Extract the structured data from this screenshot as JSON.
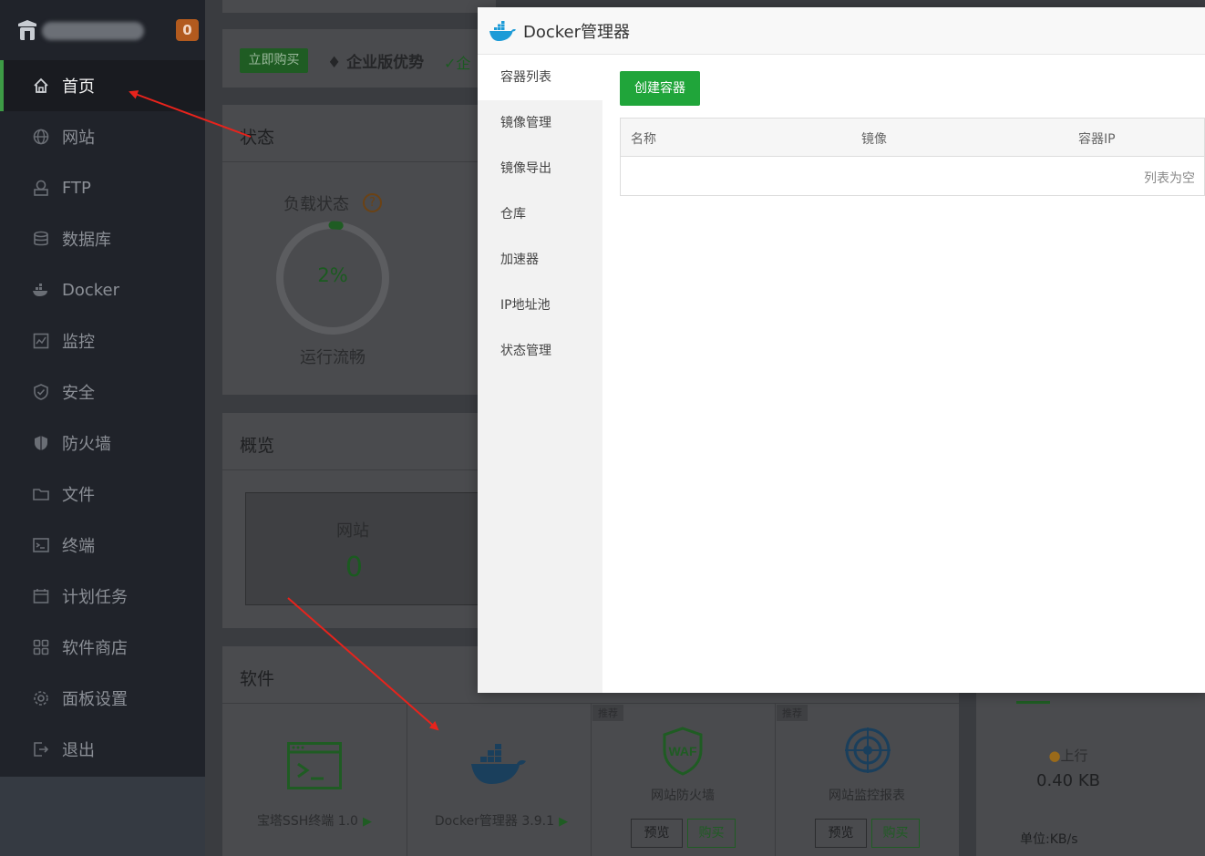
{
  "sidebar": {
    "badge": "0",
    "items": [
      {
        "label": "首页",
        "icon": "home-icon"
      },
      {
        "label": "网站",
        "icon": "globe-icon"
      },
      {
        "label": "FTP",
        "icon": "ftp-icon"
      },
      {
        "label": "数据库",
        "icon": "database-icon"
      },
      {
        "label": "Docker",
        "icon": "docker-icon"
      },
      {
        "label": "监控",
        "icon": "monitor-icon"
      },
      {
        "label": "安全",
        "icon": "shield-icon"
      },
      {
        "label": "防火墙",
        "icon": "firewall-icon"
      },
      {
        "label": "文件",
        "icon": "folder-icon"
      },
      {
        "label": "终端",
        "icon": "terminal-icon"
      },
      {
        "label": "计划任务",
        "icon": "calendar-icon"
      },
      {
        "label": "软件商店",
        "icon": "apps-icon"
      },
      {
        "label": "面板设置",
        "icon": "gear-icon"
      },
      {
        "label": "退出",
        "icon": "logout-icon"
      }
    ]
  },
  "topbar": {
    "buy_label": "立即购买",
    "enterprise_label": "企业版优势",
    "check_label": "企"
  },
  "status": {
    "title": "状态",
    "load_label": "负载状态",
    "help": "?",
    "load_value": "2%",
    "load_percent": 2,
    "load_state": "运行流畅"
  },
  "overview": {
    "title": "概览",
    "site_label": "网站",
    "site_value": "0"
  },
  "software": {
    "title": "软件",
    "items": [
      {
        "name": "宝塔SSH终端 1.0"
      },
      {
        "name": "Docker管理器 3.9.1"
      },
      {
        "name": "网站防火墙",
        "tag": "推荐",
        "preview": "预览",
        "buy": "购买"
      },
      {
        "name": "网站监控报表",
        "tag": "推荐",
        "preview": "预览",
        "buy": "购买"
      }
    ],
    "waf_text": "WAF"
  },
  "traffic": {
    "up_label": "上行",
    "up_value": "0.40 KB",
    "unit": "单位:KB/s"
  },
  "modal": {
    "title": "Docker管理器",
    "nav": [
      "容器列表",
      "镜像管理",
      "镜像导出",
      "仓库",
      "加速器",
      "IP地址池",
      "状态管理"
    ],
    "create_label": "创建容器",
    "columns": [
      "名称",
      "镜像",
      "容器IP"
    ],
    "empty_text": "列表为空"
  },
  "colors": {
    "accent_green": "#20a53a",
    "sidebar_bg": "#20232a",
    "arrow_red": "#e8231c"
  }
}
